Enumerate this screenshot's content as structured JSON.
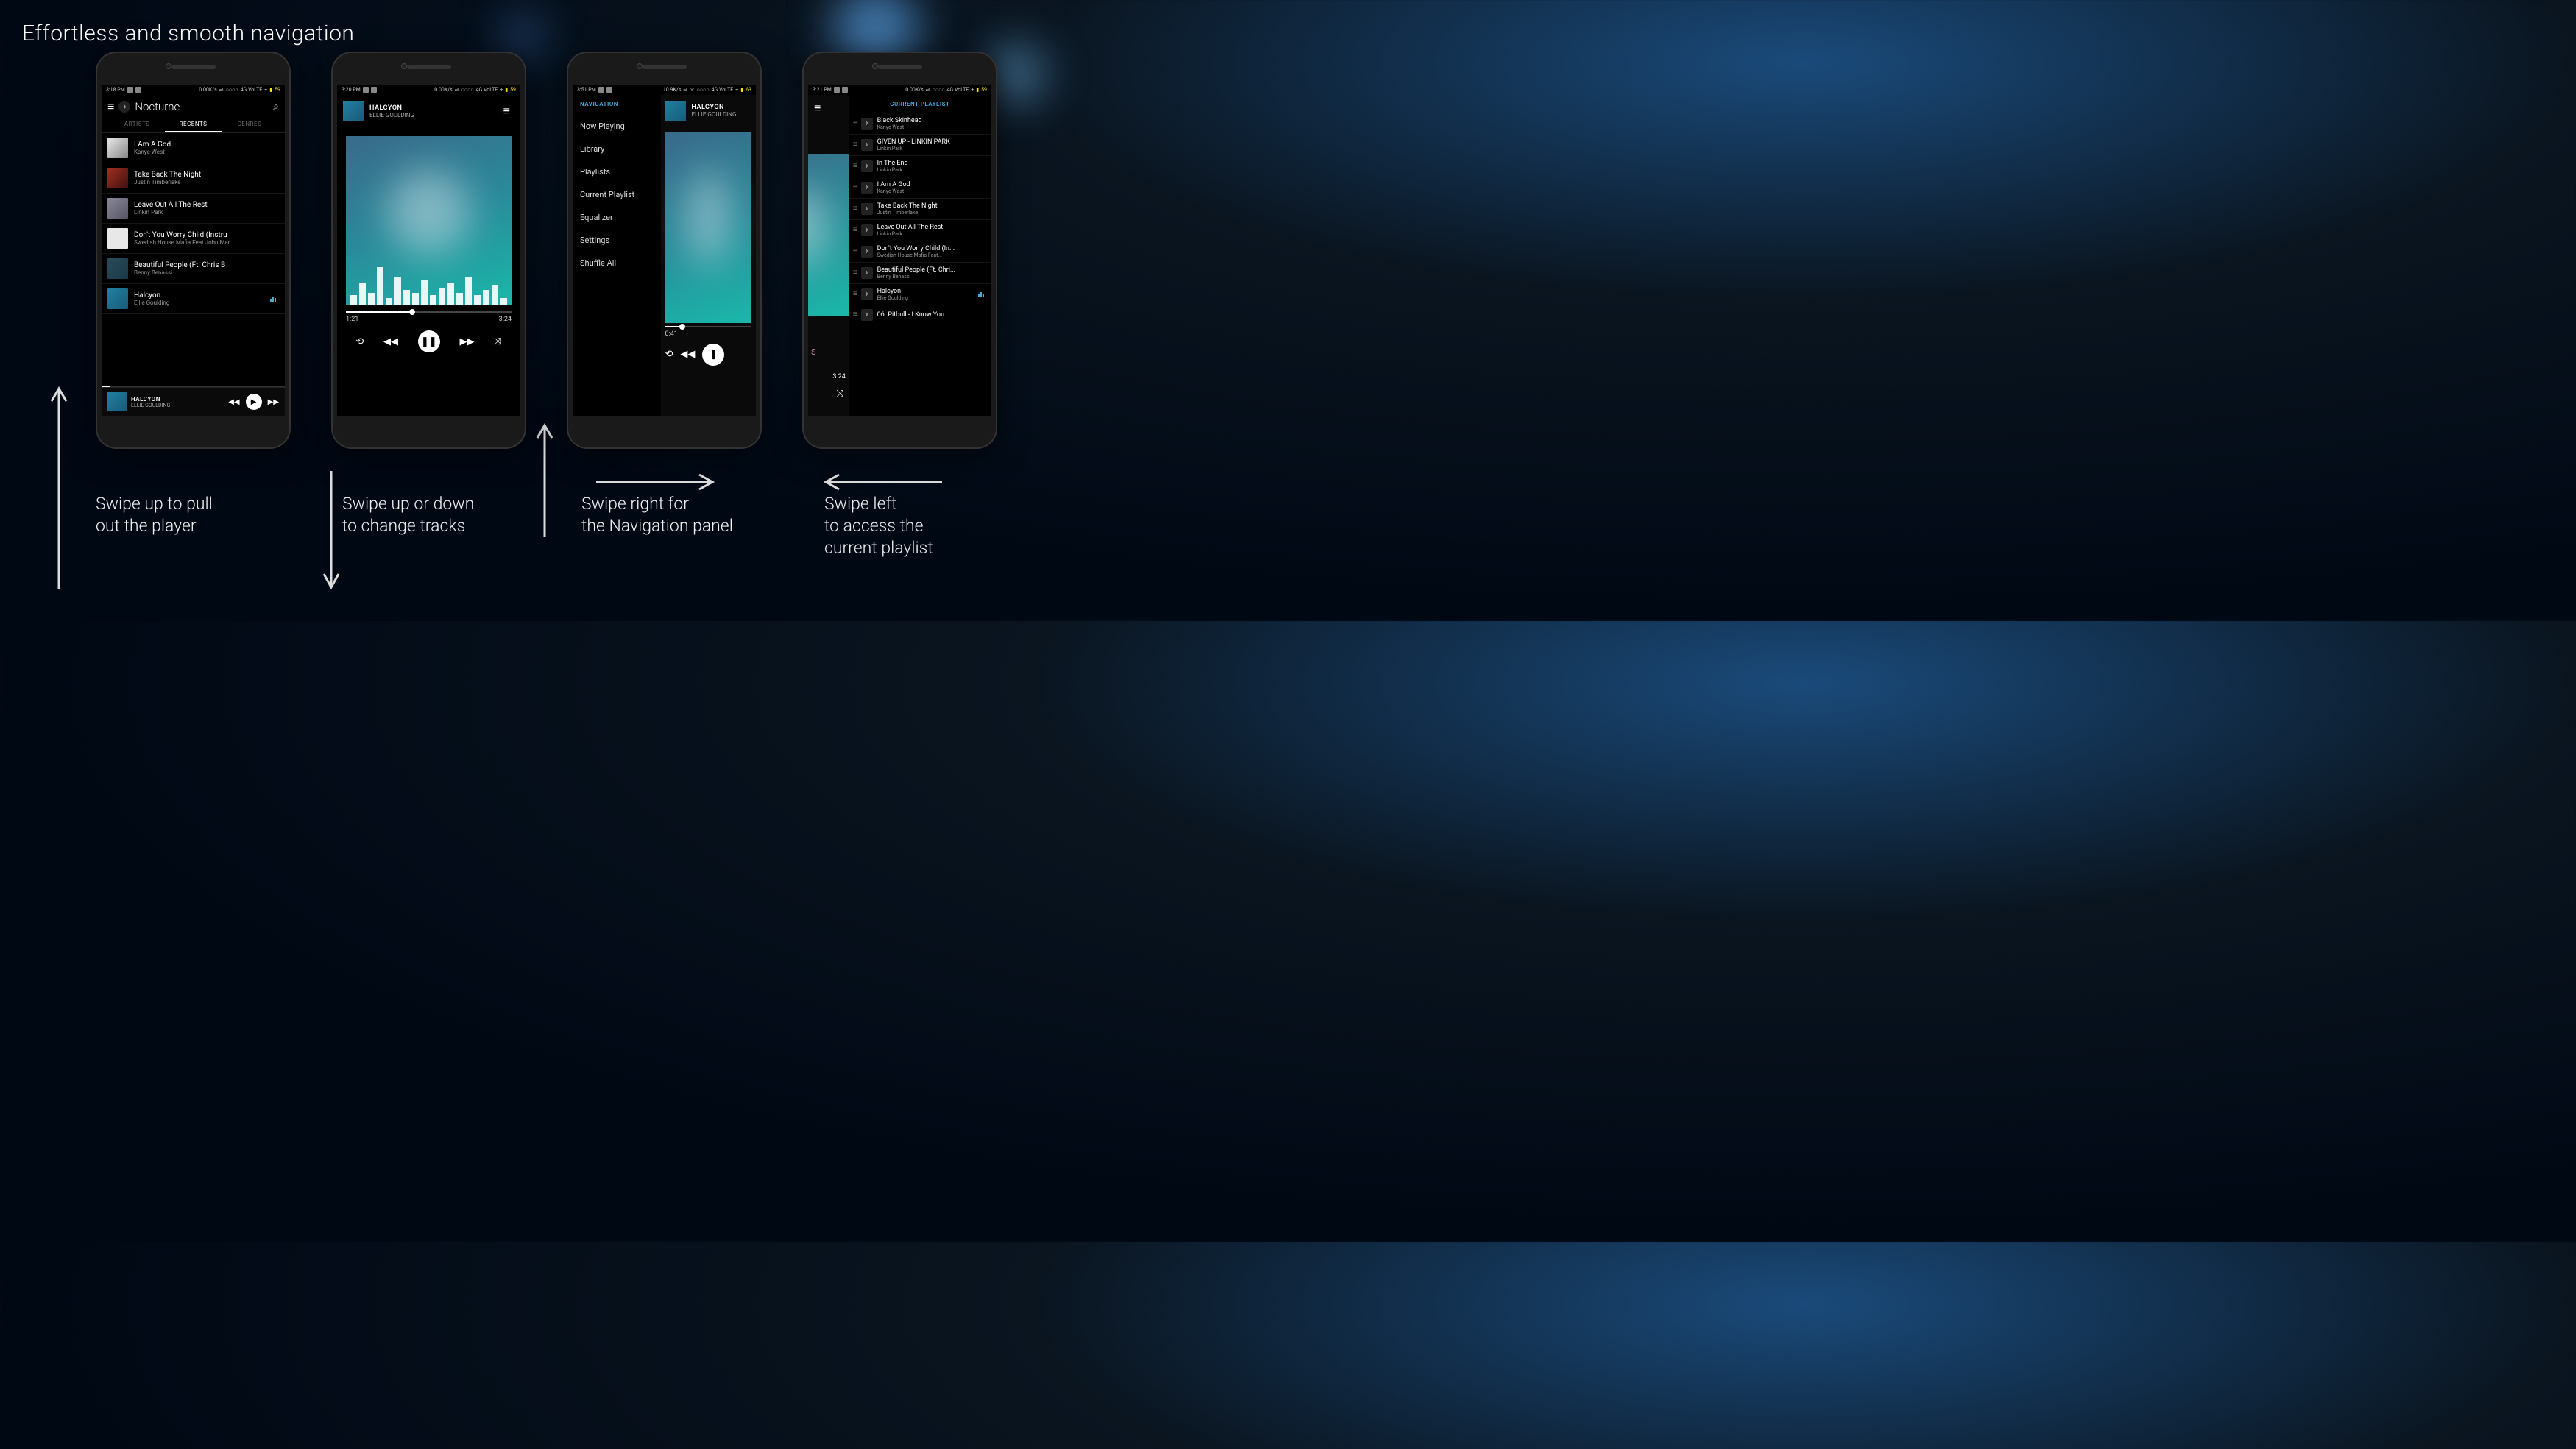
{
  "headline": "Effortless and smooth navigation",
  "captions": {
    "c1": "Swipe up to pull\nout the player",
    "c2": "Swipe up or down\nto change tracks",
    "c3": "Swipe right for\nthe Navigation panel",
    "c4": "Swipe left\nto access the\ncurrent playlist"
  },
  "app_name": "Nocturne",
  "phone1": {
    "status": {
      "time": "3:18 PM",
      "rate": "0.00K/s",
      "net": "4G VoLTE",
      "batt": "59"
    },
    "tabs": [
      "ARTISTS",
      "RECENTS",
      "GENRES"
    ],
    "tracks": [
      {
        "title": "I Am A God",
        "artist": "Kanye West"
      },
      {
        "title": "Take Back The Night",
        "artist": "Justin Timberlake"
      },
      {
        "title": "Leave Out All The Rest",
        "artist": "Linkin Park"
      },
      {
        "title": "Don't You Worry Child (Instru",
        "artist": "Swedish House Mafia Feat John Mar..."
      },
      {
        "title": "Beautiful People (Ft. Chris B",
        "artist": "Benny Benassi"
      },
      {
        "title": "Halcyon",
        "artist": "Ellie Goulding"
      }
    ],
    "mini": {
      "title": "HALCYON",
      "artist": "ELLIE GOULDING"
    }
  },
  "phone2": {
    "status": {
      "time": "3:20 PM",
      "rate": "0.00K/s",
      "net": "4G VoLTE",
      "batt": "59"
    },
    "np": {
      "title": "HALCYON",
      "artist": "ELLIE GOULDING",
      "elapsed": "1:21",
      "total": "3:24",
      "progress_pct": 40
    }
  },
  "phone3": {
    "status": {
      "time": "3:51 PM",
      "rate": "10.9K/s",
      "net": "4G VoLTE",
      "batt": "63"
    },
    "nav_title": "NAVIGATION",
    "nav_items": [
      "Now Playing",
      "Library",
      "Playlists",
      "Current Playlist",
      "Equalizer",
      "Settings",
      "Shuffle All"
    ],
    "np": {
      "title": "HALCYON",
      "artist": "ELLIE GOULDING",
      "elapsed": "0:41",
      "progress_pct": 20
    }
  },
  "phone4": {
    "status": {
      "time": "3:21 PM",
      "rate": "0.00K/s",
      "net": "4G VoLTE",
      "batt": "59"
    },
    "pl_title": "CURRENT PLAYLIST",
    "peek_time": "3:24",
    "tracks": [
      {
        "title": "Black Skinhead",
        "artist": "Kanye West"
      },
      {
        "title": "GIVEN UP - LINKIN PARK",
        "artist": "Linkin Park"
      },
      {
        "title": "In The End",
        "artist": "Linkin Park"
      },
      {
        "title": "I Am A God",
        "artist": "Kanye West"
      },
      {
        "title": "Take Back The Night",
        "artist": "Justin Timberlake"
      },
      {
        "title": "Leave Out All The Rest",
        "artist": "Linkin Park"
      },
      {
        "title": "Don't You Worry Child (In...",
        "artist": "Swedish House Mafia Feat..."
      },
      {
        "title": "Beautiful People (Ft. Chri...",
        "artist": "Benny Benassi"
      },
      {
        "title": "Halcyon",
        "artist": "Ellie Goulding"
      },
      {
        "title": "06. Pitbull - I Know You",
        "artist": ""
      }
    ]
  }
}
